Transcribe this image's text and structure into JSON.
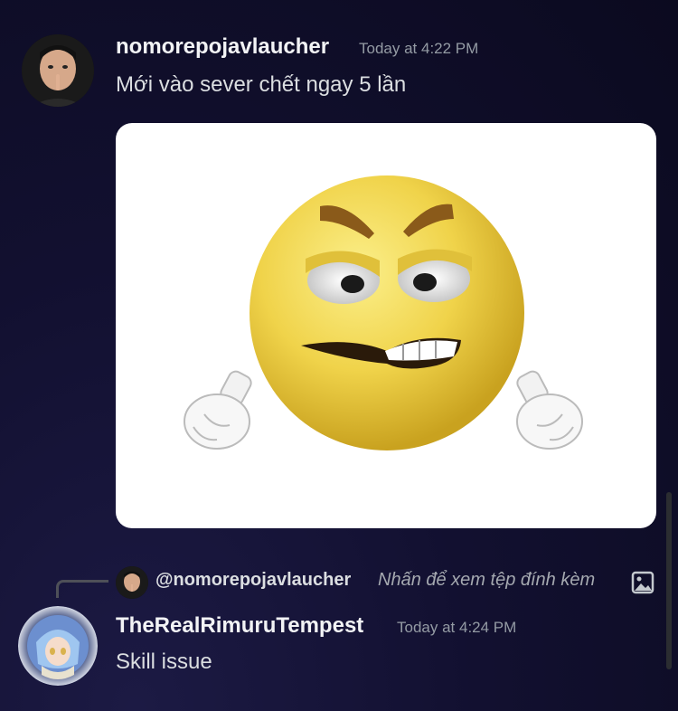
{
  "messages": [
    {
      "author": "nomorepojavlaucher",
      "timestamp": "Today at 4:22 PM",
      "content": "Mới vào sever chết ngay 5 lần",
      "attachment": "angry-emoji-image"
    },
    {
      "author": "TheRealRimuruTempest",
      "timestamp": "Today at 4:24 PM",
      "content": "Skill issue",
      "reply": {
        "mention": "@nomorepojavlaucher",
        "preview": "Nhấn để xem tệp đính kèm",
        "icon": "image-icon"
      }
    }
  ],
  "colors": {
    "background": "#0b0a1f",
    "username": "#f2f3f5",
    "timestamp": "#949ba4",
    "text": "#dbdee1",
    "emoji_yellow": "#f2d54a"
  }
}
